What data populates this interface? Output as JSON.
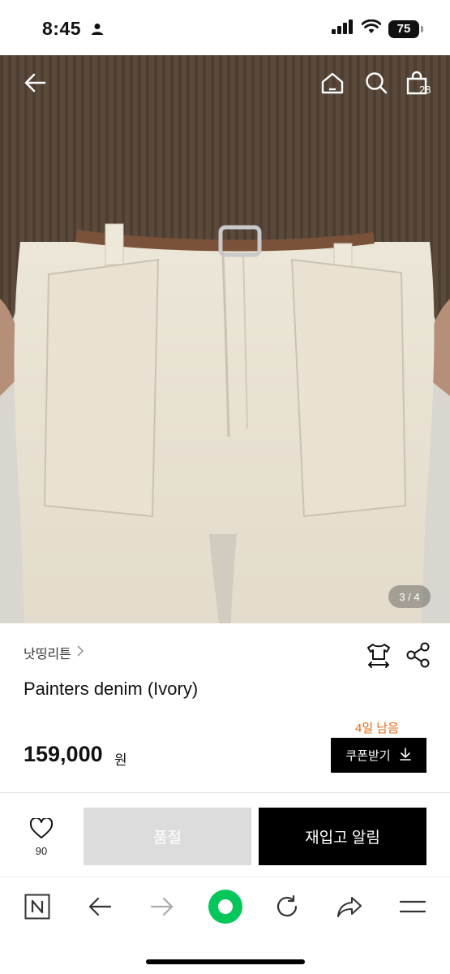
{
  "status_bar": {
    "time": "8:45",
    "battery": "75"
  },
  "gallery": {
    "counter": "3 / 4",
    "cart_count": "28"
  },
  "product": {
    "brand": "낫띵리튼",
    "name": "Painters denim (Ivory)",
    "coupon_deadline": "4일 남음",
    "price": "159,000",
    "price_unit": "원",
    "coupon_button": "쿠폰받기"
  },
  "actions": {
    "like_count": "90",
    "soldout_label": "품절",
    "restock_label": "재입고 알림"
  },
  "colors": {
    "accent_orange": "#e2660f",
    "soldout_gray": "#dcdcdc",
    "browser_green": "#03c75a"
  }
}
